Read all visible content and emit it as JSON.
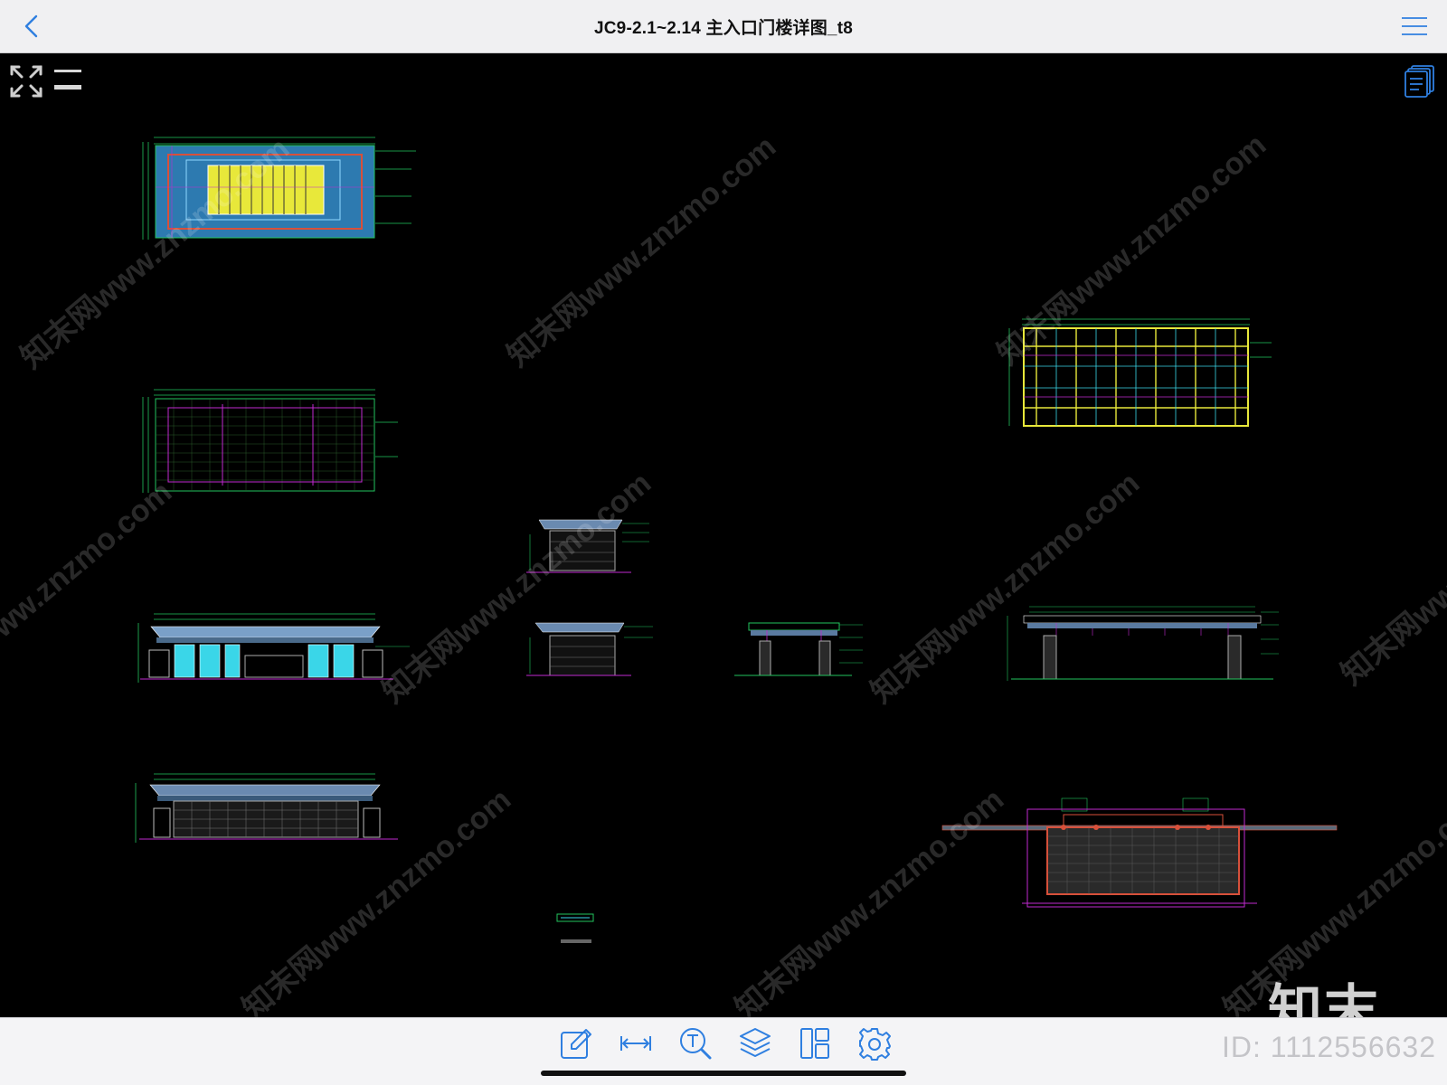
{
  "header": {
    "title": "JC9-2.1~2.14 主入口门楼详图_t8"
  },
  "icons": {
    "back": "chevron-left-icon",
    "menu": "hamburger-menu-icon",
    "expand": "expand-arrows-icon",
    "layers_toggle": "layer-lines-icon",
    "sheets": "sheets-stack-icon"
  },
  "toolbar": {
    "tools": [
      {
        "name": "markup-tool",
        "icon": "pencil-edit-icon"
      },
      {
        "name": "measure-tool",
        "icon": "ruler-measure-icon"
      },
      {
        "name": "text-search-tool",
        "icon": "text-search-icon"
      },
      {
        "name": "layers-tool",
        "icon": "layers-stack-icon"
      },
      {
        "name": "layout-tool",
        "icon": "layout-panels-icon"
      },
      {
        "name": "settings-tool",
        "icon": "gear-icon"
      }
    ]
  },
  "watermark": {
    "text": "知末网www.znzmo.com",
    "brand": "知末",
    "id_label": "ID: 1112556632"
  },
  "colors": {
    "accent": "#2f7fe0",
    "cad_green": "#22c55e",
    "cad_yellow": "#e8e83a",
    "cad_cyan": "#3ad6e8",
    "cad_magenta": "#c02ad0",
    "cad_red": "#d8503a",
    "cad_blue": "#3a7ad8"
  }
}
